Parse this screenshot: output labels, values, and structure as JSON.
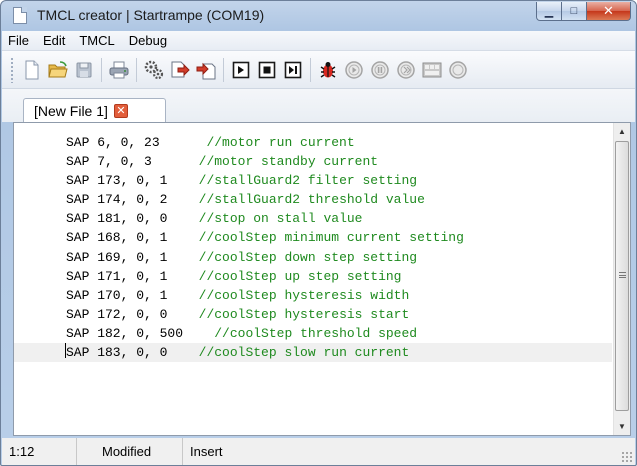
{
  "window": {
    "title": "TMCL creator | Startrampe (COM19)",
    "controls": {
      "minimize": "▁",
      "maximize": "□",
      "close": "✕"
    }
  },
  "menu": [
    "File",
    "Edit",
    "TMCL",
    "Debug"
  ],
  "toolbar": {
    "icons": [
      "new-file-icon",
      "open-folder-icon",
      "save-icon",
      "print-icon",
      "compile-icon",
      "download-icon",
      "upload-icon",
      "run-icon",
      "stop-icon",
      "step-icon",
      "debug-bug-icon",
      "circle-play-icon",
      "circle-pause-icon",
      "circle-stop-icon",
      "film-icon",
      "circle-icon"
    ]
  },
  "tabs": [
    {
      "label": "[New File 1]",
      "close": "✕"
    }
  ],
  "editor": {
    "lines": [
      {
        "code": "SAP 6, 0, 23",
        "pad": "      ",
        "comment": "//motor run current"
      },
      {
        "code": "SAP 7, 0, 3",
        "pad": "      ",
        "comment": "//motor standby current"
      },
      {
        "code": "SAP 173, 0, 1",
        "pad": "    ",
        "comment": "//stallGuard2 filter setting"
      },
      {
        "code": "SAP 174, 0, 2",
        "pad": "    ",
        "comment": "//stallGuard2 threshold value"
      },
      {
        "code": "SAP 181, 0, 0",
        "pad": "    ",
        "comment": "//stop on stall value"
      },
      {
        "code": "SAP 168, 0, 1",
        "pad": "    ",
        "comment": "//coolStep minimum current setting"
      },
      {
        "code": "SAP 169, 0, 1",
        "pad": "    ",
        "comment": "//coolStep down step setting"
      },
      {
        "code": "SAP 171, 0, 1",
        "pad": "    ",
        "comment": "//coolStep up step setting"
      },
      {
        "code": "SAP 170, 0, 1",
        "pad": "    ",
        "comment": "//coolStep hysteresis width"
      },
      {
        "code": "SAP 172, 0, 0",
        "pad": "    ",
        "comment": "//coolStep hysteresis start"
      },
      {
        "code": "SAP 182, 0, 500",
        "pad": "    ",
        "comment": "//coolStep threshold speed"
      },
      {
        "code": "SAP 183, 0, 0",
        "pad": "    ",
        "comment": "//coolStep slow run current"
      }
    ],
    "scroll_up": "▲",
    "scroll_down": "▼"
  },
  "status": {
    "position": "1:12",
    "modified": "Modified",
    "mode": "Insert"
  },
  "colors": {
    "comment": "#1f8a1f",
    "title_bar": "#c2d4ea",
    "close_button": "#c5371b"
  }
}
